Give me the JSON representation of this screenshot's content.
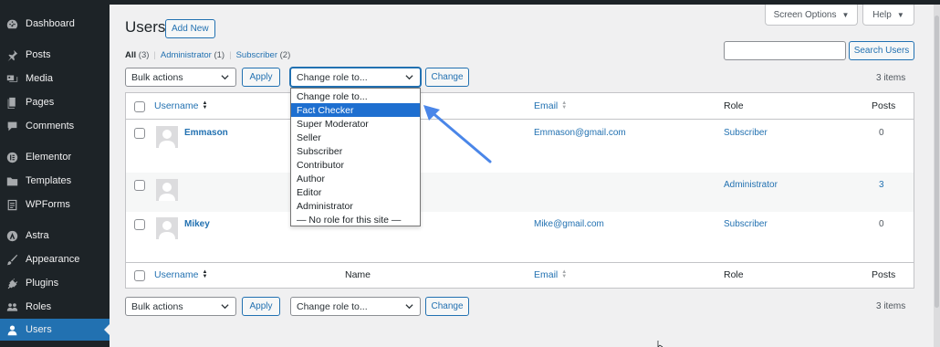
{
  "sidebar": {
    "items": [
      {
        "label": "Dashboard",
        "icon": "dashboard-icon"
      },
      {
        "label": "Posts",
        "icon": "pin-icon"
      },
      {
        "label": "Media",
        "icon": "media-icon"
      },
      {
        "label": "Pages",
        "icon": "pages-icon"
      },
      {
        "label": "Comments",
        "icon": "comment-icon"
      },
      {
        "label": "Elementor",
        "icon": "elementor-icon"
      },
      {
        "label": "Templates",
        "icon": "folder-icon"
      },
      {
        "label": "WPForms",
        "icon": "wpforms-icon"
      },
      {
        "label": "Astra",
        "icon": "astra-icon"
      },
      {
        "label": "Appearance",
        "icon": "brush-icon"
      },
      {
        "label": "Plugins",
        "icon": "plug-icon"
      },
      {
        "label": "Roles",
        "icon": "roles-icon"
      },
      {
        "label": "Users",
        "icon": "user-icon",
        "active": true
      }
    ]
  },
  "header": {
    "screen_options": "Screen Options",
    "help": "Help",
    "title": "Users",
    "add_new": "Add New"
  },
  "filters": {
    "all": "All",
    "all_count": "(3)",
    "administrator": "Administrator",
    "administrator_count": "(1)",
    "subscriber": "Subscriber",
    "subscriber_count": "(2)",
    "separator": "|"
  },
  "search": {
    "value": "",
    "button": "Search Users"
  },
  "top_nav": {
    "bulk_actions": "Bulk actions",
    "apply": "Apply",
    "change_role": "Change role to...",
    "change": "Change",
    "items": "3 items"
  },
  "bottom_nav": {
    "bulk_actions": "Bulk actions",
    "apply": "Apply",
    "change_role": "Change role to...",
    "change": "Change",
    "items": "3 items"
  },
  "table": {
    "columns": {
      "username": "Username",
      "name": "Name",
      "email": "Email",
      "role": "Role",
      "posts": "Posts"
    },
    "rows": [
      {
        "username": "Emmason",
        "email": "Emmason@gmail.com",
        "role": "Subscriber",
        "posts": "0"
      },
      {
        "username": "",
        "email": "",
        "role": "Administrator",
        "posts": "3"
      },
      {
        "username": "Mikey",
        "email": "Mike@gmail.com",
        "role": "Subscriber",
        "posts": "0"
      }
    ]
  },
  "role_dropdown": {
    "selected": "Fact Checker",
    "options": [
      "Change role to...",
      "Fact Checker",
      "Super Moderator",
      "Seller",
      "Subscriber",
      "Contributor",
      "Author",
      "Editor",
      "Administrator",
      "— No role for this site —"
    ]
  },
  "colors": {
    "sidebar_bg": "#1d2327",
    "accent": "#2271b1",
    "selection": "#1e6fd0",
    "arrow": "#4a86e8"
  }
}
